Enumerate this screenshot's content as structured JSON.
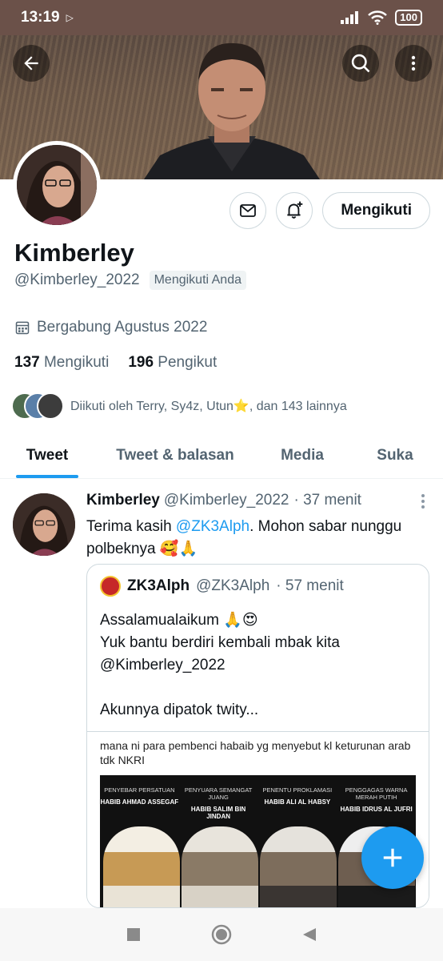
{
  "status_bar": {
    "time": "13:19",
    "battery": "100"
  },
  "profile": {
    "name": "Kimberley",
    "handle": "@Kimberley_2022",
    "follows_you": "Mengikuti Anda",
    "joined": "Bergabung Agustus 2022",
    "following_count": "137",
    "following_label": "Mengikuti",
    "followers_count": "196",
    "followers_label": "Pengikut",
    "followed_by": "Diikuti oleh Terry, Sy4z, Utun⭐, dan 143 lainnya",
    "follow_button": "Mengikuti"
  },
  "tabs": [
    {
      "label": "Tweet",
      "active": true
    },
    {
      "label": "Tweet & balasan",
      "active": false
    },
    {
      "label": "Media",
      "active": false
    },
    {
      "label": "Suka",
      "active": false
    }
  ],
  "tweet": {
    "author": "Kimberley",
    "handle": "@Kimberley_2022",
    "time": "· 37 menit",
    "text_before": "Terima kasih ",
    "mention": "@ZK3Alph",
    "text_after": ". Mohon sabar nunggu polbeknya 🥰🙏",
    "quote": {
      "author": "ZK3Alph",
      "handle": "@ZK3Alph",
      "time": "· 57 menit",
      "lines": [
        "Assalamualaikum 🙏😍",
        "Yuk bantu berdiri kembali mbak kita",
        "@Kimberley_2022",
        "",
        "Akunnya dipatok twity..."
      ],
      "image_caption": "mana ni para pembenci habaib yg menyebut kl keturunan arab tdk NKRI",
      "image_labels": [
        {
          "role": "PENYEBAR PERSATUAN",
          "name": "HABIB AHMAD ASSEGAF"
        },
        {
          "role": "PENYUARA SEMANGAT JUANG",
          "name": "HABIB SALIM BIN JINDAN"
        },
        {
          "role": "PENENTU PROKLAMASI",
          "name": "HABIB ALI AL HABSY"
        },
        {
          "role": "PENGGAGAS WARNA MERAH PUTIH",
          "name": "HABIB IDRUS AL JUFRI"
        }
      ]
    }
  },
  "icons": [
    "back-arrow-icon",
    "search-icon",
    "more-vertical-icon",
    "mail-icon",
    "bell-plus-icon",
    "calendar-icon",
    "plus-icon",
    "nav-recents-icon",
    "nav-home-icon",
    "nav-back-icon"
  ],
  "colors": {
    "accent": "#1d9bf0",
    "secondary_text": "#536471",
    "status_bar": "#6b5149"
  }
}
